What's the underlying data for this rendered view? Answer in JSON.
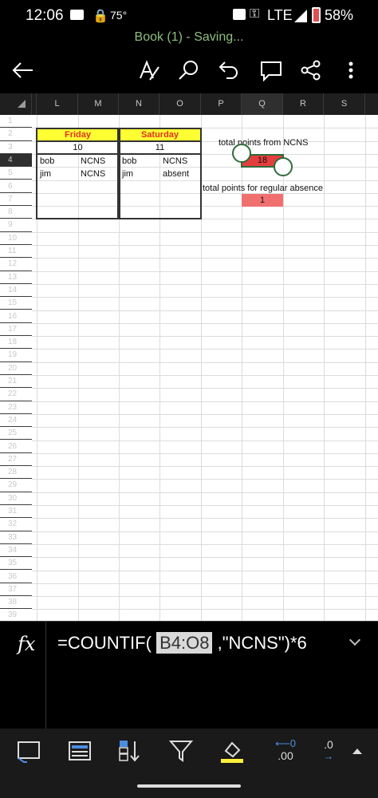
{
  "status_bar": {
    "time": "12:06",
    "temperature": "75°",
    "network": "LTE",
    "battery": "58%"
  },
  "title": "Book (1) - Saving...",
  "toolbar": {
    "icons": [
      "back-arrow-icon",
      "draw-pen-icon",
      "search-icon",
      "undo-icon",
      "comment-icon",
      "share-icon",
      "more-icon"
    ]
  },
  "columns": [
    "L",
    "M",
    "N",
    "O",
    "P",
    "Q",
    "R",
    "S"
  ],
  "rows": [
    "1",
    "2",
    "3",
    "4",
    "5",
    "6",
    "7",
    "8",
    "9",
    "10",
    "11",
    "12",
    "13",
    "14",
    "15",
    "16",
    "17",
    "18",
    "19",
    "20",
    "21",
    "22",
    "23",
    "24",
    "25",
    "26",
    "27",
    "28",
    "29",
    "30",
    "31",
    "32",
    "33",
    "34",
    "35",
    "36",
    "37",
    "38",
    "39"
  ],
  "sheet": {
    "friday_label": "Friday",
    "saturday_label": "Saturday",
    "friday_num": "10",
    "saturday_num": "11",
    "r4": [
      "bob",
      "NCNS",
      "bob",
      "NCNS"
    ],
    "r5": [
      "jim",
      "NCNS",
      "jim",
      "absent"
    ],
    "total_ncns_label": "total points from NCNS",
    "total_ncns_value": "18",
    "total_absence_label": "total points for regular absence",
    "total_absence_value": "1"
  },
  "formula_bar": {
    "fx_label": "fx",
    "prefix": "=COUNTIF(",
    "range_ref": "B4:O8",
    "suffix": ",\"NCNS\")*6"
  },
  "ribbon": {
    "icons": [
      "cell-styles-icon",
      "format-table-icon",
      "sort-icon",
      "filter-icon",
      "fill-color-icon",
      "decrease-decimal-icon",
      "increase-decimal-icon",
      "expand-up-icon"
    ],
    "decrease_decimal": ".00",
    "increase_decimal": ".0"
  },
  "colors": {
    "header_yellow": "#ffff33",
    "header_text": "#e0321e",
    "red_cell": "#f07070",
    "selected_cell": "#e53e3e",
    "selection_border": "#2e6b3a",
    "title_green": "#8fbf7f"
  }
}
